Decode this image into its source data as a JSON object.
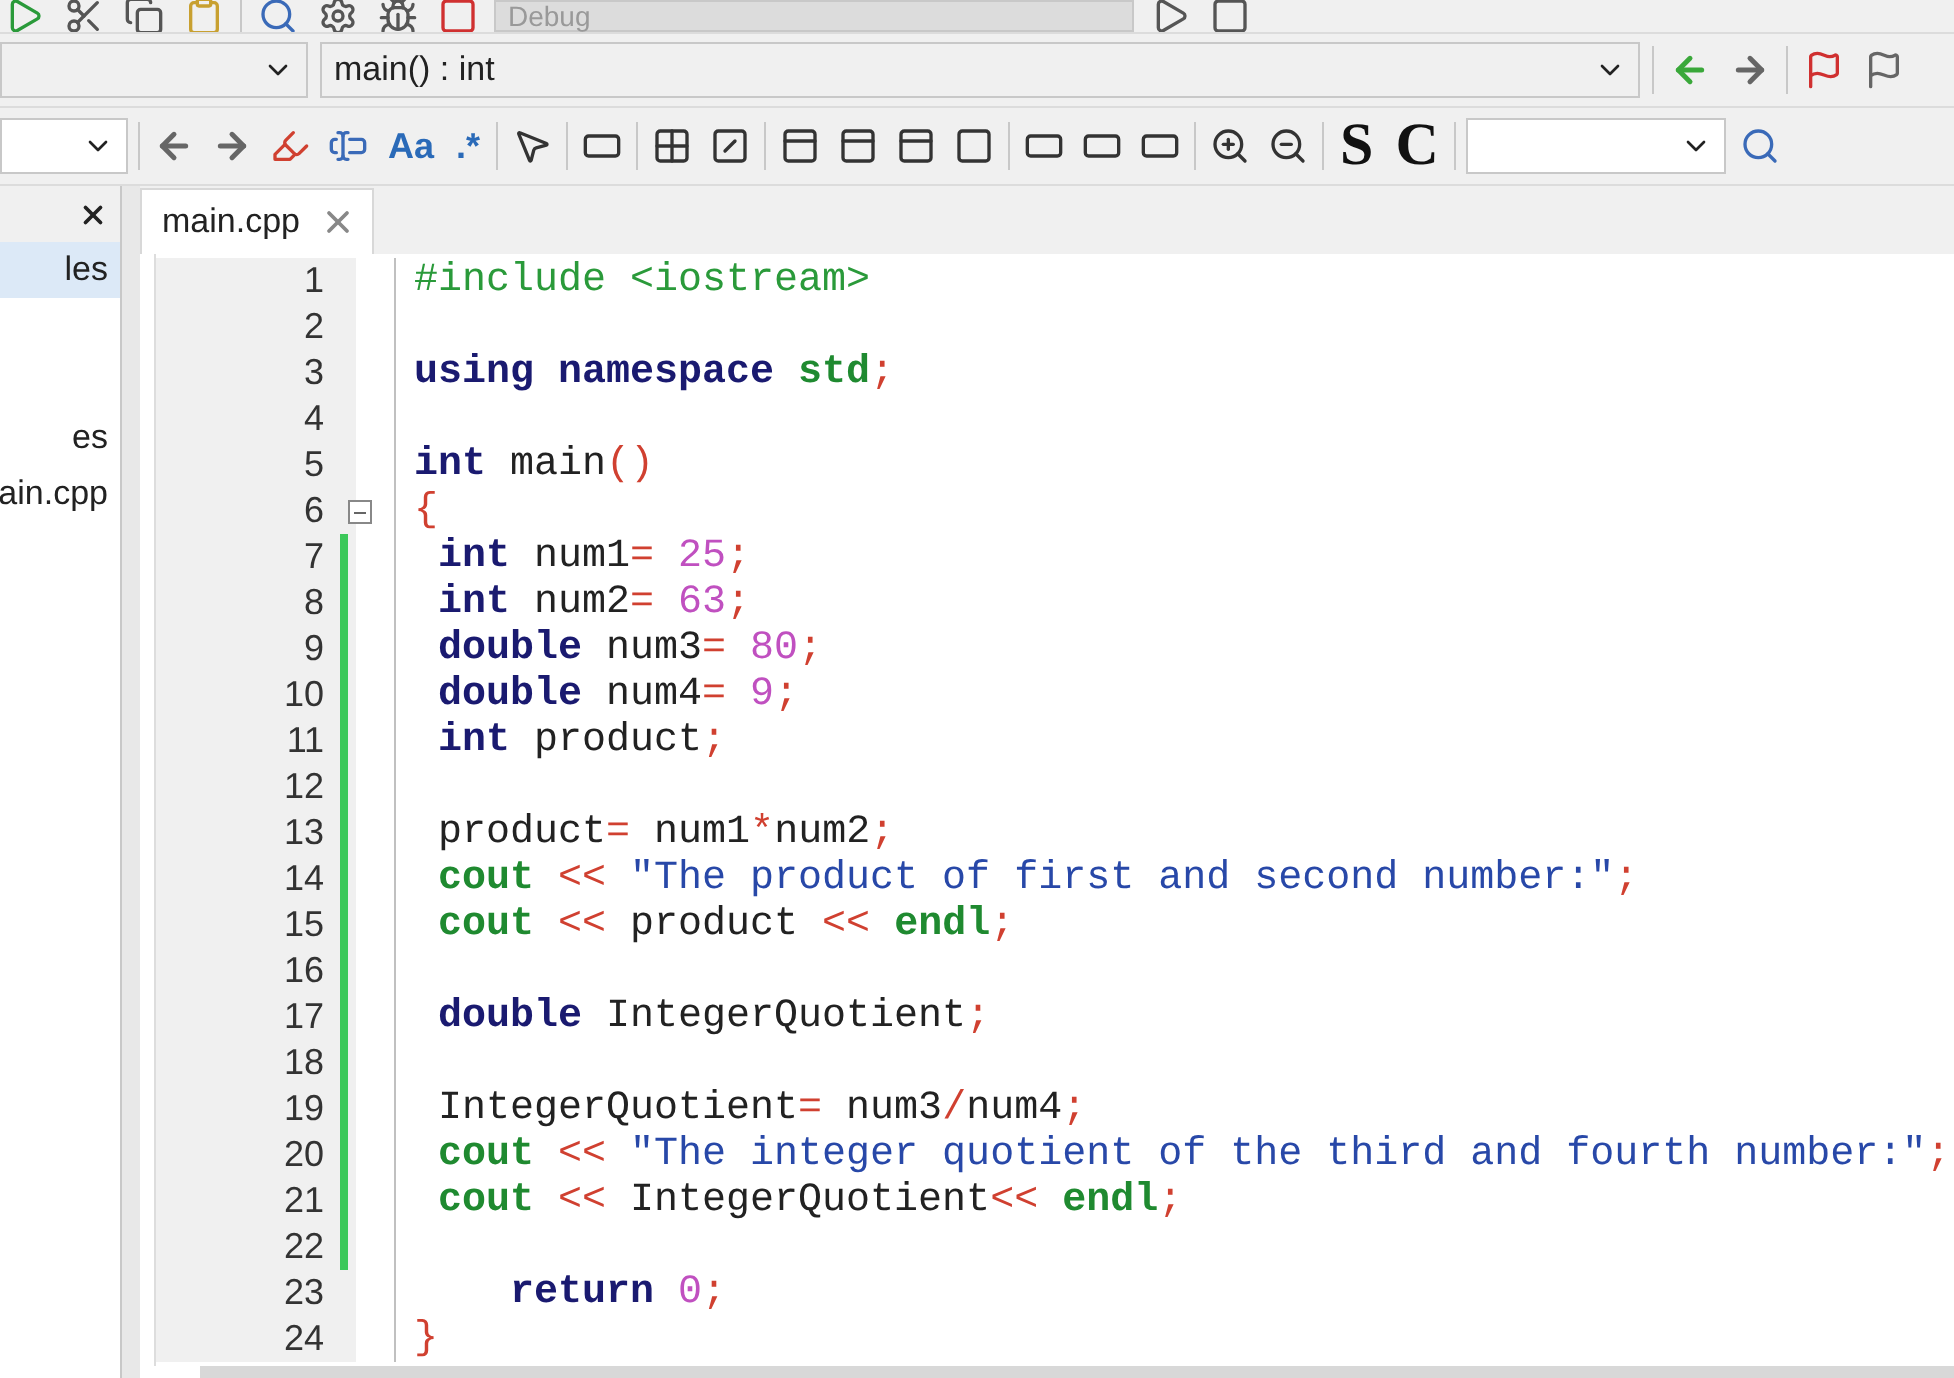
{
  "toolbar_top": {
    "build_target": "Debug"
  },
  "toolbar_middle": {
    "function_select": "main() : int"
  },
  "toolbar_bottom": {
    "text_buttons": [
      "Aa",
      ".*"
    ],
    "style_buttons": [
      "S",
      "C"
    ]
  },
  "side_panel": {
    "items": [
      {
        "label": "les",
        "selected": true
      },
      {
        "label": "es",
        "selected": false
      },
      {
        "label": "ain.cpp",
        "selected": false
      }
    ]
  },
  "tabs": [
    {
      "label": "main.cpp",
      "selected": true
    }
  ],
  "editor": {
    "lines": [
      {
        "number": "1",
        "changed": false,
        "fold": false,
        "tokens": [
          {
            "kind": "preprocessor",
            "text": "#include <iostream>"
          }
        ]
      },
      {
        "number": "2",
        "changed": false,
        "fold": false
      },
      {
        "number": "3",
        "changed": false,
        "fold": false,
        "tokens": [
          {
            "kind": "keyword",
            "text": "using"
          },
          {
            "kind": "keyword",
            "text": " namespace"
          },
          {
            "kind": "builtin",
            "text": " std"
          },
          {
            "kind": "operator",
            "text": ";"
          }
        ]
      },
      {
        "number": "4",
        "changed": false,
        "fold": false
      },
      {
        "number": "5",
        "changed": false,
        "fold": false,
        "tokens": [
          {
            "kind": "keyword",
            "text": "int"
          },
          {
            "kind": "plain",
            "text": " main"
          },
          {
            "kind": "operator",
            "text": "()"
          }
        ]
      },
      {
        "number": "6",
        "changed": false,
        "fold": true,
        "tokens": [
          {
            "kind": "operator",
            "text": "{"
          }
        ]
      },
      {
        "number": "7",
        "changed": true,
        "fold": false,
        "tokens": [
          {
            "kind": "keyword",
            "text": " int"
          },
          {
            "kind": "plain",
            "text": " num1"
          },
          {
            "kind": "operator",
            "text": "="
          },
          {
            "kind": "number",
            "text": " 25"
          },
          {
            "kind": "operator",
            "text": ";"
          }
        ]
      },
      {
        "number": "8",
        "changed": true,
        "fold": false,
        "tokens": [
          {
            "kind": "keyword",
            "text": " int"
          },
          {
            "kind": "plain",
            "text": " num2"
          },
          {
            "kind": "operator",
            "text": "="
          },
          {
            "kind": "number",
            "text": " 63"
          },
          {
            "kind": "operator",
            "text": ";"
          }
        ]
      },
      {
        "number": "9",
        "changed": true,
        "fold": false,
        "tokens": [
          {
            "kind": "keyword",
            "text": " double"
          },
          {
            "kind": "plain",
            "text": " num3"
          },
          {
            "kind": "operator",
            "text": "="
          },
          {
            "kind": "number",
            "text": " 80"
          },
          {
            "kind": "operator",
            "text": ";"
          }
        ]
      },
      {
        "number": "10",
        "changed": true,
        "fold": false,
        "tokens": [
          {
            "kind": "keyword",
            "text": " double"
          },
          {
            "kind": "plain",
            "text": " num4"
          },
          {
            "kind": "operator",
            "text": "="
          },
          {
            "kind": "number",
            "text": " 9"
          },
          {
            "kind": "operator",
            "text": ";"
          }
        ]
      },
      {
        "number": "11",
        "changed": true,
        "fold": false,
        "tokens": [
          {
            "kind": "keyword",
            "text": " int"
          },
          {
            "kind": "plain",
            "text": " product"
          },
          {
            "kind": "operator",
            "text": ";"
          }
        ]
      },
      {
        "number": "12",
        "changed": true,
        "fold": false
      },
      {
        "number": "13",
        "changed": true,
        "fold": false,
        "tokens": [
          {
            "kind": "plain",
            "text": " product"
          },
          {
            "kind": "operator",
            "text": "="
          },
          {
            "kind": "plain",
            "text": " num1"
          },
          {
            "kind": "operator",
            "text": "*"
          },
          {
            "kind": "plain",
            "text": "num2"
          },
          {
            "kind": "operator",
            "text": ";"
          }
        ]
      },
      {
        "number": "14",
        "changed": true,
        "fold": false,
        "tokens": [
          {
            "kind": "builtin",
            "text": " cout"
          },
          {
            "kind": "operator",
            "text": " <<"
          },
          {
            "kind": "string",
            "text": " \"The product of first and second number:\""
          },
          {
            "kind": "operator",
            "text": ";"
          }
        ]
      },
      {
        "number": "15",
        "changed": true,
        "fold": false,
        "tokens": [
          {
            "kind": "builtin",
            "text": " cout"
          },
          {
            "kind": "operator",
            "text": " <<"
          },
          {
            "kind": "plain",
            "text": " product"
          },
          {
            "kind": "operator",
            "text": " <<"
          },
          {
            "kind": "builtin",
            "text": " endl"
          },
          {
            "kind": "operator",
            "text": ";"
          }
        ]
      },
      {
        "number": "16",
        "changed": true,
        "fold": false
      },
      {
        "number": "17",
        "changed": true,
        "fold": false,
        "tokens": [
          {
            "kind": "keyword",
            "text": " double"
          },
          {
            "kind": "plain",
            "text": " IntegerQuotient"
          },
          {
            "kind": "operator",
            "text": ";"
          }
        ]
      },
      {
        "number": "18",
        "changed": true,
        "fold": false
      },
      {
        "number": "19",
        "changed": true,
        "fold": false,
        "tokens": [
          {
            "kind": "plain",
            "text": " IntegerQuotient"
          },
          {
            "kind": "operator",
            "text": "="
          },
          {
            "kind": "plain",
            "text": " num3"
          },
          {
            "kind": "operator",
            "text": "/"
          },
          {
            "kind": "plain",
            "text": "num4"
          },
          {
            "kind": "operator",
            "text": ";"
          }
        ]
      },
      {
        "number": "20",
        "changed": true,
        "fold": false,
        "tokens": [
          {
            "kind": "builtin",
            "text": " cout"
          },
          {
            "kind": "operator",
            "text": " <<"
          },
          {
            "kind": "string",
            "text": " \"The integer quotient of the third and fourth number:\""
          },
          {
            "kind": "operator",
            "text": ";"
          }
        ]
      },
      {
        "number": "21",
        "changed": true,
        "fold": false,
        "tokens": [
          {
            "kind": "builtin",
            "text": " cout"
          },
          {
            "kind": "operator",
            "text": " <<"
          },
          {
            "kind": "plain",
            "text": " IntegerQuotient"
          },
          {
            "kind": "operator",
            "text": "<<"
          },
          {
            "kind": "builtin",
            "text": " endl"
          },
          {
            "kind": "operator",
            "text": ";"
          }
        ]
      },
      {
        "number": "22",
        "changed": true,
        "fold": false
      },
      {
        "number": "23",
        "changed": false,
        "fold": false,
        "tokens": [
          {
            "kind": "keyword",
            "text": "    return"
          },
          {
            "kind": "number",
            "text": " 0"
          },
          {
            "kind": "operator",
            "text": ";"
          }
        ]
      },
      {
        "number": "24",
        "changed": false,
        "fold": false,
        "tokens": [
          {
            "kind": "operator",
            "text": "}"
          }
        ]
      }
    ]
  }
}
